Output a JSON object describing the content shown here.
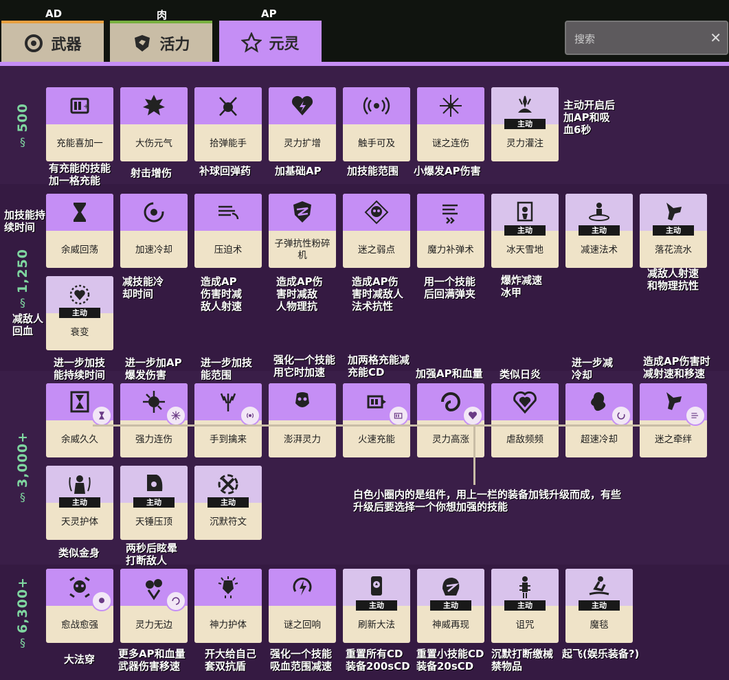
{
  "top_labels": {
    "ad": "AD",
    "meat": "肉",
    "ap": "AP"
  },
  "tabs": [
    {
      "label": "武器",
      "icon": "weapon-icon",
      "color": "#e8a040"
    },
    {
      "label": "活力",
      "icon": "vitality-icon",
      "color": "#78b040"
    },
    {
      "label": "元灵",
      "icon": "spirit-icon",
      "color": "#c58ef5"
    }
  ],
  "search": {
    "placeholder": "搜索",
    "clear": "✕"
  },
  "active_badge": "主动",
  "tiers": [
    {
      "price": "500",
      "items": [
        "充能喜加一",
        "大伤元气",
        "拾弹能手",
        "灵力扩增",
        "触手可及",
        "谜之连伤",
        "灵力灌注"
      ]
    },
    {
      "price": "1,250",
      "items": [
        "余威回荡",
        "加速冷却",
        "压迫术",
        "子弹抗性粉碎机",
        "迷之弱点",
        "魔力补弹术",
        "冰天雪地",
        "减速法术",
        "落花流水",
        "衰变"
      ]
    },
    {
      "price": "3,000+",
      "items": [
        "余威久久",
        "强力连伤",
        "手到擒来",
        "澎湃灵力",
        "火速充能",
        "灵力高涨",
        "虐敌频频",
        "超速冷却",
        "迷之牵绊",
        "天灵护体",
        "天锤压顶",
        "沉默符文"
      ]
    },
    {
      "price": "6,300+",
      "items": [
        "愈战愈强",
        "灵力无边",
        "神力护体",
        "谜之回响",
        "刷新大法",
        "神威再现",
        "诅咒",
        "魔毯"
      ]
    }
  ],
  "annotations": {
    "t1_active": "主动开启后\n加AP和吸\n血6秒",
    "t1_0": "有充能的技能\n加一格充能",
    "t1_1": "射击增伤",
    "t1_2": "补球回弹药",
    "t1_3": "加基础AP",
    "t1_4": "加技能范围",
    "t1_5": "小爆发AP伤害",
    "t2_left": "加技能持\n续时间",
    "t2_decay": "减敌人\n回血",
    "t2_1": "减技能冷\n却时间",
    "t2_2": "造成AP\n伤害时减\n敌人射速",
    "t2_3": "造成AP伤\n害时减敌\n人物理抗",
    "t2_4": "造成AP伤\n害时减敌人\n法术抗性",
    "t2_5": "用一个技能\n后回满弹夹",
    "t2_6": "爆炸减速\n冰甲",
    "t2_8": "减敌人射速\n和物理抗性",
    "t3_0": "进一步加技\n能持续时间",
    "t3_1": "进一步加AP\n爆发伤害",
    "t3_2": "进一步加技\n能范围",
    "t3_3": "强化一个技能\n用它时加速",
    "t3_4": "加两格充能减\n充能CD",
    "t3_5": "加强AP和血量",
    "t3_6": "类似日炎",
    "t3_7": "进一步减\n冷却",
    "t3_8": "造成AP伤害时\n减射速和移速",
    "t3_note": "白色小圈内的是组件，用上一栏的装备加钱升级而成，有些\n升级后要选择一个你想加强的技能",
    "t3_9": "类似金身",
    "t3_10": "两秒后眩晕\n打断敌人",
    "t4_0": "大法穿",
    "t4_1": "更多AP和血量\n武器伤害移速",
    "t4_2": "开大给自己\n套双抗盾",
    "t4_3": "强化一个技能\n吸血范围减速",
    "t4_4": "重置所有CD\n装备200sCD",
    "t4_5": "重置小技能CD\n装备20sCD",
    "t4_6": "沉默打断缴械\n禁物品",
    "t4_7": "起飞(娱乐装备?)"
  }
}
